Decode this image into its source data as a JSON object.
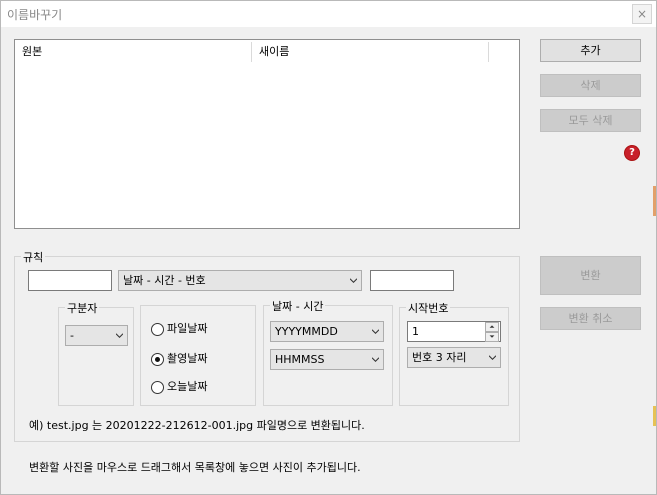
{
  "window": {
    "title": "이름바꾸기",
    "close_label": "×"
  },
  "list": {
    "columns": [
      "원본",
      "새이름"
    ]
  },
  "buttons": {
    "add": "추가",
    "delete": "삭제",
    "delete_all": "모두 삭제",
    "convert": "변환",
    "cancel_convert": "변환 취소",
    "help": "?"
  },
  "rules": {
    "group_label": "규칙",
    "prefix_value": "",
    "pattern_value": "날짜 - 시간 - 번호",
    "suffix_value": "",
    "separator": {
      "label": "구분자",
      "value": "-"
    },
    "date_source": {
      "options": [
        {
          "label": "파일날짜",
          "checked": false
        },
        {
          "label": "촬영날짜",
          "checked": true
        },
        {
          "label": "오늘날짜",
          "checked": false
        }
      ]
    },
    "datetime": {
      "label": "날짜 - 시간",
      "date_format": "YYYYMMDD",
      "time_format": "HHMMSS"
    },
    "start_number": {
      "label": "시작번호",
      "value": "1",
      "digits": "번호 3 자리"
    },
    "example_text": "예) test.jpg 는 20201222-212612-001.jpg  파일명으로 변환됩니다."
  },
  "footer_hint": "변환할 사진을 마우스로 드래그해서 목록창에 놓으면 사진이 추가됩니다.",
  "colors": {
    "help_icon": "#c8202a",
    "window_bg": "#f0f0f0"
  }
}
